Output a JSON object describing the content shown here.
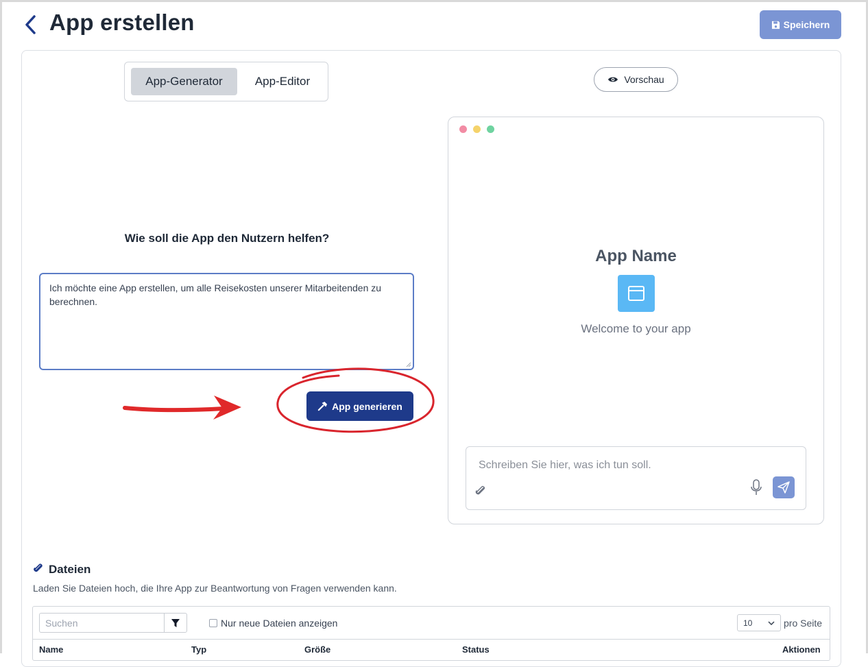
{
  "header": {
    "title": "App erstellen",
    "save_label": "Speichern"
  },
  "generator": {
    "tabs": [
      {
        "label": "App-Generator",
        "active": true
      },
      {
        "label": "App-Editor",
        "active": false
      }
    ],
    "question": "Wie soll die App den Nutzern helfen?",
    "prompt_value": "Ich möchte eine App erstellen, um alle Reisekosten unserer Mitarbeitenden zu berechnen.",
    "generate_label": "App generieren"
  },
  "preview": {
    "button_label": "Vorschau",
    "app_name": "App Name",
    "welcome": "Welcome to your app",
    "chat_placeholder": "Schreiben Sie hier, was ich tun soll."
  },
  "files": {
    "title": "Dateien",
    "description": "Laden Sie Dateien hoch, die Ihre App zur Beantwortung von Fragen verwenden kann.",
    "search_placeholder": "Suchen",
    "only_new_label": "Nur neue Dateien anzeigen",
    "per_page_value": "10",
    "per_page_label": "pro Seite",
    "columns": [
      "Name",
      "Typ",
      "Größe",
      "Status",
      "Aktionen"
    ]
  },
  "colors": {
    "primary": "#1e3a8a",
    "save_button": "#7b95d4",
    "annotation_red": "#e0292a",
    "app_icon": "#5ab8f5"
  }
}
